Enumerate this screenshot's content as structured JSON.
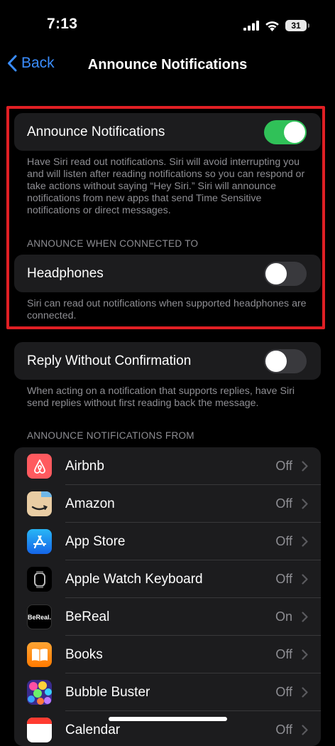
{
  "status": {
    "time": "7:13",
    "battery": "31"
  },
  "nav": {
    "back_label": "Back",
    "title": "Announce Notifications"
  },
  "announce": {
    "label": "Announce Notifications",
    "enabled": true,
    "footer": "Have Siri read out notifications. Siri will avoid interrupting you and will listen after reading notifications so you can respond or take actions without saying “Hey Siri.” Siri will announce notifications from new apps that send Time Sensitive notifications or direct messages."
  },
  "connected_to": {
    "header": "ANNOUNCE WHEN CONNECTED TO",
    "headphones_label": "Headphones",
    "headphones_enabled": false,
    "footer": "Siri can read out notifications when supported headphones are connected."
  },
  "reply": {
    "label": "Reply Without Confirmation",
    "enabled": false,
    "footer": "When acting on a notification that supports replies, have Siri send replies without first reading back the message."
  },
  "apps_section": {
    "header": "ANNOUNCE NOTIFICATIONS FROM",
    "apps": [
      {
        "name": "Airbnb",
        "value": "Off",
        "icon": "airbnb-icon"
      },
      {
        "name": "Amazon",
        "value": "Off",
        "icon": "amazon-icon"
      },
      {
        "name": "App Store",
        "value": "Off",
        "icon": "app-store-icon"
      },
      {
        "name": "Apple Watch Keyboard",
        "value": "Off",
        "icon": "apple-watch-keyboard-icon"
      },
      {
        "name": "BeReal",
        "value": "On",
        "icon": "bereal-icon"
      },
      {
        "name": "Books",
        "value": "Off",
        "icon": "books-icon"
      },
      {
        "name": "Bubble Buster",
        "value": "Off",
        "icon": "bubble-buster-icon"
      },
      {
        "name": "Calendar",
        "value": "Off",
        "icon": "calendar-icon"
      }
    ],
    "bereal_icon_text": "BeReal."
  },
  "colors": {
    "accent": "#3a8dff",
    "toggle_on": "#30c158",
    "highlight": "#e01f24"
  }
}
